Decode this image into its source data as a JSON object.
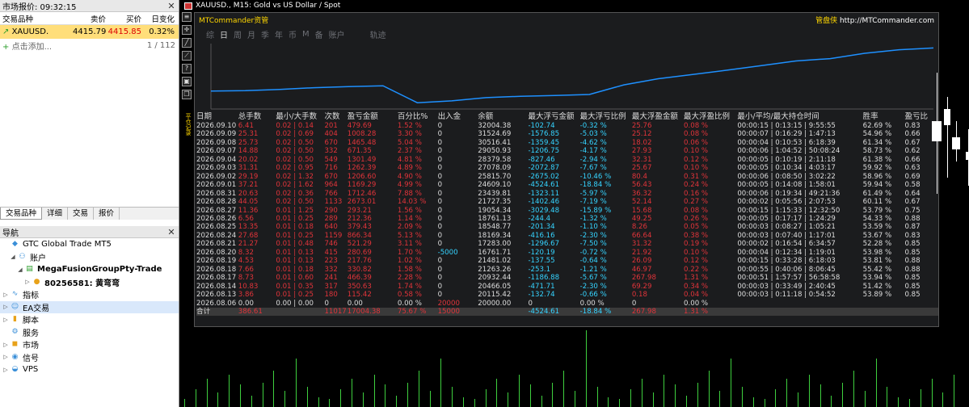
{
  "market": {
    "title": "市场报价: 09:32:15",
    "headers": [
      "交易品种",
      "卖价",
      "买价",
      "日变化"
    ],
    "rows": [
      {
        "symbol": "XAUUSD.",
        "bid": "4415.79",
        "ask": "4415.85",
        "change": "0.32%"
      }
    ],
    "add_label": "点击添加...",
    "count": "1 / 112"
  },
  "tabs": [
    "交易品种",
    "详细",
    "交易",
    "报价"
  ],
  "navigator": {
    "title": "导航",
    "items": [
      {
        "label": "GTC Global Trade MT5",
        "level": 0,
        "icon": "gtc-logo-icon",
        "arrow": ""
      },
      {
        "label": "账户",
        "level": 1,
        "icon": "accounts-icon",
        "arrow": "◢"
      },
      {
        "label": "MegaFusionGroupPty-Trade",
        "level": 2,
        "icon": "server-icon",
        "arrow": "◢",
        "bold": true
      },
      {
        "label": "80256581: 黄弯弯",
        "level": 3,
        "icon": "user-icon",
        "arrow": "▷",
        "bold": true
      },
      {
        "label": "指标",
        "level": 0,
        "icon": "indicators-icon",
        "arrow": "▷"
      },
      {
        "label": "EA交易",
        "level": 0,
        "icon": "expert-advisors-icon",
        "arrow": "▷",
        "sel": true
      },
      {
        "label": "脚本",
        "level": 0,
        "icon": "scripts-icon",
        "arrow": "▷"
      },
      {
        "label": "服务",
        "level": 0,
        "icon": "services-icon",
        "arrow": ""
      },
      {
        "label": "市场",
        "level": 0,
        "icon": "market-icon",
        "arrow": "▷"
      },
      {
        "label": "信号",
        "level": 0,
        "icon": "signals-icon",
        "arrow": "▷"
      },
      {
        "label": "VPS",
        "level": 0,
        "icon": "vps-icon",
        "arrow": "▷"
      }
    ]
  },
  "chart_title": "XAUUSD., M15:  Gold vs US Dollar / Spot",
  "panel": {
    "title": "MTCommander资管",
    "brand": "管盘侠",
    "url": " http://MTCommander.com",
    "tabs": [
      "综",
      "日",
      "周",
      "月",
      "季",
      "年",
      "币",
      "M",
      "备",
      "账户",
      "轨迹"
    ],
    "start_date": "2026.08.13",
    "end_date": "2026.09.10",
    "side_label": "平仓记录",
    "headers": [
      "日期",
      "总手数",
      "最小/大手数",
      "次数",
      "盈亏金额",
      "百分比%",
      "出入金",
      "余额",
      "最大浮亏金额",
      "最大浮亏比例",
      "最大浮盈金额",
      "最大浮盈比例",
      "最小/平均/最大持仓时间",
      "胜率",
      "盈亏比"
    ],
    "rows": [
      [
        "2026.09.10",
        "6.41",
        "0.02 | 0.14",
        "201",
        "479.69",
        "1.52 %",
        "0",
        "32004.38",
        "-102.74",
        "-0.32 %",
        "25.76",
        "0.08 %",
        "00:00:15 | 0:13:15 | 9:55:55",
        "62.69 %",
        "0.83"
      ],
      [
        "2026.09.09",
        "25.31",
        "0.02 | 0.69",
        "404",
        "1008.28",
        "3.30 %",
        "0",
        "31524.69",
        "-1576.85",
        "-5.03 %",
        "25.12",
        "0.08 %",
        "00:00:07 | 0:16:29 | 1:47:13",
        "54.96 %",
        "0.66"
      ],
      [
        "2026.09.08",
        "25.73",
        "0.02 | 0.50",
        "670",
        "1465.48",
        "5.04 %",
        "0",
        "30516.41",
        "-1359.45",
        "-4.62 %",
        "18.02",
        "0.06 %",
        "00:00:04 | 0:10:53 | 6:18:39",
        "61.34 %",
        "0.67"
      ],
      [
        "2026.09.07",
        "14.88",
        "0.02 | 0.50",
        "332",
        "671.35",
        "2.37 %",
        "0",
        "29050.93",
        "-1206.75",
        "-4.17 %",
        "27.93",
        "0.10 %",
        "00:00:06 | 1:04:52 | 50:08:24",
        "58.73 %",
        "0.62"
      ],
      [
        "2026.09.04",
        "20.02",
        "0.02 | 0.50",
        "549",
        "1301.49",
        "4.81 %",
        "0",
        "28379.58",
        "-827.46",
        "-2.94 %",
        "32.31",
        "0.12 %",
        "00:00:05 | 0:10:19 | 2:11:18",
        "61.38 %",
        "0.66"
      ],
      [
        "2026.09.03",
        "31.31",
        "0.02 | 0.95",
        "716",
        "1262.39",
        "4.89 %",
        "0",
        "27078.09",
        "-2072.87",
        "-7.67 %",
        "25.67",
        "0.10 %",
        "00:00:05 | 0:10:34 | 4:03:17",
        "59.92 %",
        "0.63"
      ],
      [
        "2026.09.02",
        "29.19",
        "0.02 | 1.32",
        "670",
        "1206.60",
        "4.90 %",
        "0",
        "25815.70",
        "-2675.02",
        "-10.46 %",
        "80.4",
        "0.31 %",
        "00:00:06 | 0:08:50 | 3:02:22",
        "58.96 %",
        "0.69"
      ],
      [
        "2026.09.01",
        "37.21",
        "0.02 | 1.62",
        "964",
        "1169.29",
        "4.99 %",
        "0",
        "24609.10",
        "-4524.61",
        "-18.84 %",
        "56.43",
        "0.24 %",
        "00:00:05 | 0:14:08 | 1:58:01",
        "59.94 %",
        "0.58"
      ],
      [
        "2026.08.31",
        "20.63",
        "0.02 | 0.36",
        "766",
        "1712.46",
        "7.88 %",
        "0",
        "23439.81",
        "-1323.11",
        "-5.97 %",
        "36.32",
        "0.16 %",
        "00:00:06 | 0:19:34 | 49:21:36",
        "61.49 %",
        "0.64"
      ],
      [
        "2026.08.28",
        "44.05",
        "0.02 | 0.50",
        "1133",
        "2673.01",
        "14.03 %",
        "0",
        "21727.35",
        "-1402.46",
        "-7.19 %",
        "52.14",
        "0.27 %",
        "00:00:02 | 0:05:56 | 2:07:53",
        "60.11 %",
        "0.67"
      ],
      [
        "2026.08.27",
        "11.36",
        "0.01 | 1.25",
        "290",
        "293.21",
        "1.56 %",
        "0",
        "19054.34",
        "-3029.48",
        "-15.89 %",
        "15.68",
        "0.08 %",
        "00:00:15 | 1:15:33 | 12:32:50",
        "53.79 %",
        "0.75"
      ],
      [
        "2026.08.26",
        "6.56",
        "0.01 | 0.25",
        "289",
        "212.36",
        "1.14 %",
        "0",
        "18761.13",
        "-244.4",
        "-1.32 %",
        "49.25",
        "0.26 %",
        "00:00:05 | 0:17:17 | 1:24:29",
        "54.33 %",
        "0.88"
      ],
      [
        "2026.08.25",
        "13.35",
        "0.01 | 0.18",
        "640",
        "379.43",
        "2.09 %",
        "0",
        "18548.77",
        "-201.34",
        "-1.10 %",
        "8.26",
        "0.05 %",
        "00:00:03 | 0:08:27 | 1:05:21",
        "53.59 %",
        "0.87"
      ],
      [
        "2026.08.24",
        "27.68",
        "0.01 | 0.25",
        "1159",
        "866.34",
        "5.13 %",
        "0",
        "18169.34",
        "-416.16",
        "-2.30 %",
        "66.64",
        "0.38 %",
        "00:00:03 | 0:07:40 | 1:17:01",
        "53.67 %",
        "0.83"
      ],
      [
        "2026.08.21",
        "21.27",
        "0.01 | 0.48",
        "746",
        "521.29",
        "3.11 %",
        "0",
        "17283.00",
        "-1296.67",
        "-7.50 %",
        "31.32",
        "0.19 %",
        "00:00:02 | 0:16:54 | 6:34:57",
        "52.28 %",
        "0.85"
      ],
      [
        "2026.08.20",
        "8.32",
        "0.01 | 0.13",
        "415",
        "280.69",
        "1.70 %",
        "-5000",
        "16761.71",
        "-120.19",
        "-0.72 %",
        "21.92",
        "0.10 %",
        "00:00:04 | 0:12:34 | 1:19:01",
        "53.98 %",
        "0.85"
      ],
      [
        "2026.08.19",
        "4.53",
        "0.01 | 0.13",
        "223",
        "217.76",
        "1.02 %",
        "0",
        "21481.02",
        "-137.55",
        "-0.64 %",
        "26.09",
        "0.12 %",
        "00:00:15 | 0:33:28 | 6:18:03",
        "53.81 %",
        "0.88"
      ],
      [
        "2026.08.18",
        "7.66",
        "0.01 | 0.18",
        "332",
        "330.82",
        "1.58 %",
        "0",
        "21263.26",
        "-253.1",
        "-1.21 %",
        "46.97",
        "0.22 %",
        "00:00:55 | 0:40:06 | 8:06:45",
        "55.42 %",
        "0.88"
      ],
      [
        "2026.08.17",
        "8.73",
        "0.01 | 0.60",
        "241",
        "466.39",
        "2.28 %",
        "0",
        "20932.44",
        "-1186.88",
        "-5.67 %",
        "267.98",
        "1.31 %",
        "00:00:51 | 1:57:57 | 56:58:58",
        "53.94 %",
        "0.85"
      ],
      [
        "2026.08.14",
        "10.83",
        "0.01 | 0.35",
        "317",
        "350.63",
        "1.74 %",
        "0",
        "20466.05",
        "-471.71",
        "-2.30 %",
        "69.29",
        "0.34 %",
        "00:00:03 | 0:33:49 | 2:40:45",
        "51.42 %",
        "0.85"
      ],
      [
        "2026.08.13",
        "3.86",
        "0.01 | 0.25",
        "180",
        "115.42",
        "0.58 %",
        "0",
        "20115.42",
        "-132.74",
        "-0.66 %",
        "0.18",
        "0.04 %",
        "00:00:03 | 0:11:18 | 0:54:52",
        "53.89 %",
        "0.85"
      ],
      [
        "2026.08.06",
        "0.00",
        "0.00 | 0.00",
        "0",
        "0.00",
        "0.00 %",
        "20000",
        "20000.00",
        "0",
        "0.00 %",
        "0",
        "0.00 %",
        "",
        "",
        ""
      ]
    ],
    "total": [
      "合计",
      "386.61",
      "",
      "11017",
      "17004.38",
      "75.67 %",
      "15000",
      "",
      "-4524.61",
      "-18.84 %",
      "267.98",
      "1.31 %",
      "",
      "",
      ""
    ]
  },
  "chart_data": {
    "type": "line",
    "x": [
      "2026.08.06",
      "2026.08.13",
      "2026.08.14",
      "2026.08.17",
      "2026.08.18",
      "2026.08.19",
      "2026.08.20",
      "2026.08.21",
      "2026.08.24",
      "2026.08.25",
      "2026.08.26",
      "2026.08.27",
      "2026.08.28",
      "2026.08.31",
      "2026.09.01",
      "2026.09.02",
      "2026.09.03",
      "2026.09.04",
      "2026.09.07",
      "2026.09.08",
      "2026.09.09",
      "2026.09.10"
    ],
    "series": [
      {
        "values": [
          20000,
          20115.42,
          20466.05,
          20932.44,
          21263.26,
          21481.02,
          16761.71,
          17283.0,
          18169.34,
          18548.77,
          18761.13,
          19054.34,
          21727.35,
          23439.81,
          24609.1,
          25815.7,
          27078.09,
          28379.58,
          29050.93,
          30516.41,
          31524.69,
          32004.38
        ]
      }
    ],
    "colors": {
      "line": "#1e90ff"
    }
  }
}
